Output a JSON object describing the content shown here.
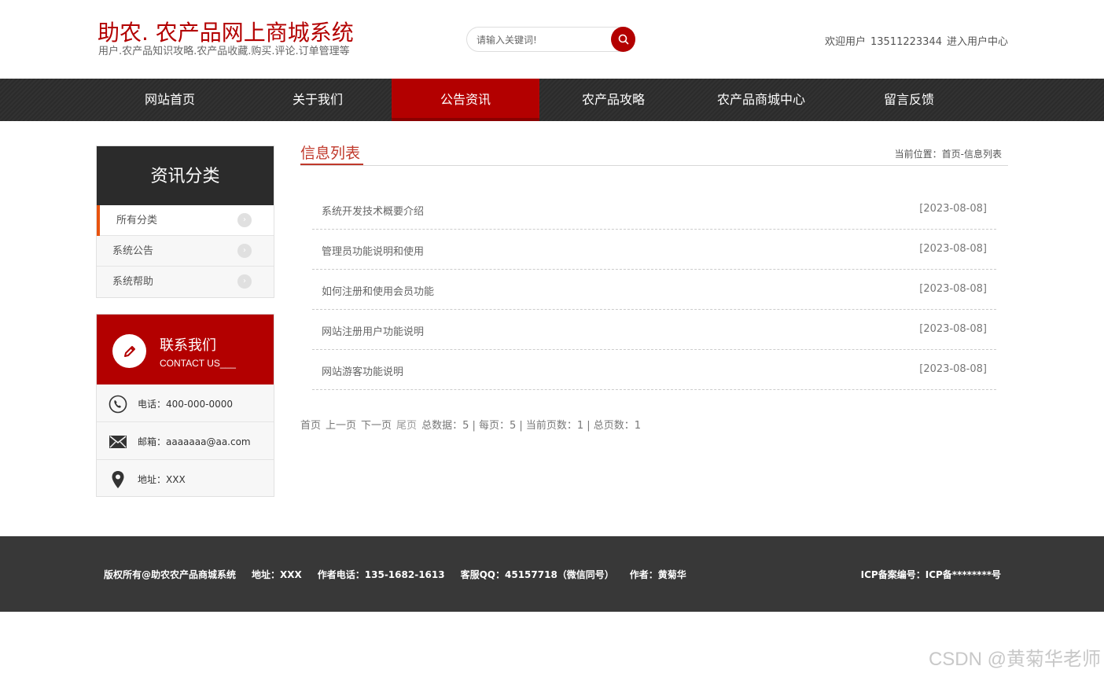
{
  "header": {
    "site_title": "助农. 农产品网上商城系统",
    "site_subtitle": "用户.农产品知识攻略.农产品收藏.购买.评论.订单管理等",
    "search_placeholder": "请输入关键词!",
    "welcome_text": "欢迎用户",
    "username": "13511223344",
    "user_center_link": "进入用户中心"
  },
  "nav": {
    "items": [
      {
        "label": "网站首页"
      },
      {
        "label": "关于我们"
      },
      {
        "label": "公告资讯"
      },
      {
        "label": "农产品攻略"
      },
      {
        "label": "农产品商城中心"
      },
      {
        "label": "留言反馈"
      }
    ],
    "active_index": 2
  },
  "sidebar": {
    "category_title": "资讯分类",
    "categories": [
      {
        "label": "所有分类"
      },
      {
        "label": "系统公告"
      },
      {
        "label": "系统帮助"
      }
    ],
    "contact": {
      "title": "联系我们",
      "subtitle": "CONTACT US___",
      "phone": "电话：400-000-0000",
      "email": "邮箱：aaaaaaa@aa.com",
      "address": "地址：XXX"
    }
  },
  "main": {
    "section_title": "信息列表",
    "breadcrumb": "当前位置：首页-信息列表",
    "news": [
      {
        "title": "系统开发技术概要介绍",
        "date": "[2023-08-08]"
      },
      {
        "title": "管理员功能说明和使用",
        "date": "[2023-08-08]"
      },
      {
        "title": "如何注册和使用会员功能",
        "date": "[2023-08-08]"
      },
      {
        "title": "网站注册用户功能说明",
        "date": "[2023-08-08]"
      },
      {
        "title": "网站游客功能说明",
        "date": "[2023-08-08]"
      }
    ],
    "pager": {
      "first": "首页",
      "prev": "上一页",
      "next": "下一页",
      "last": "尾页",
      "info": "总数据：5 | 每页：5 | 当前页数：1 | 总页数：1"
    }
  },
  "footer": {
    "copyright": "版权所有@助农农产品商城系统",
    "address": "地址：XXX",
    "author_phone": "作者电话：135-1682-1613",
    "qq": "客服QQ：45157718（微信同号）",
    "author": "作者：黄菊华",
    "icp": "ICP备案编号：ICP备********号"
  },
  "watermark": "CSDN @黄菊华老师",
  "colors": {
    "brand_red": "#b30000",
    "nav_dark": "#2b2b2b",
    "footer_dark": "#383838",
    "accent_orange": "#e8530e",
    "title_red": "#c0392b"
  }
}
